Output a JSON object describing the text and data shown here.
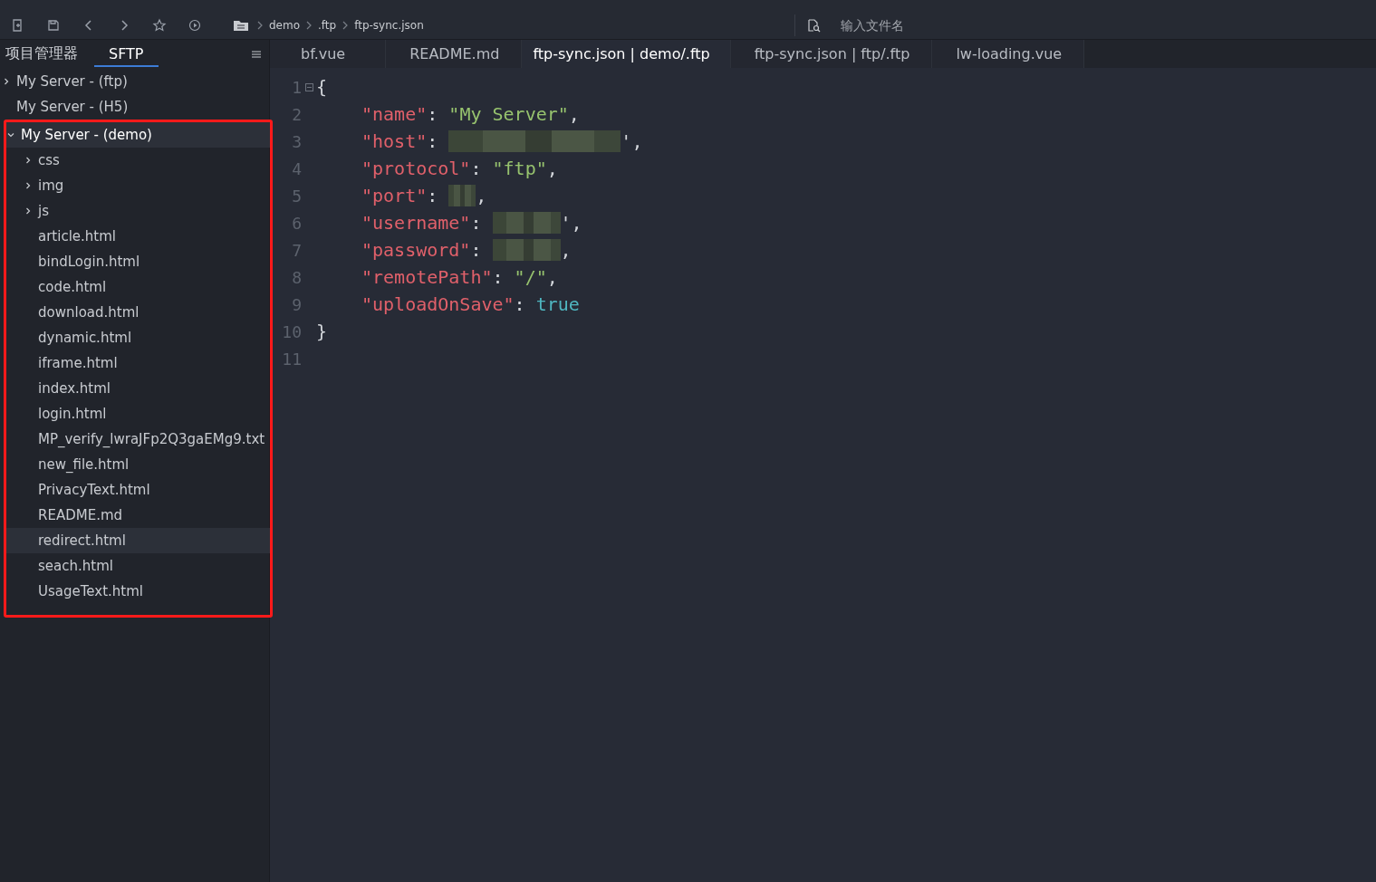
{
  "toolbar": {
    "breadcrumbs": [
      "demo",
      ".ftp",
      "ftp-sync.json"
    ],
    "search": {
      "placeholder": "输入文件名"
    }
  },
  "sidebar": {
    "tabs": [
      {
        "label": "项目管理器",
        "selected": false
      },
      {
        "label": "SFTP",
        "selected": true
      }
    ],
    "tree": [
      {
        "label": "My Server - (ftp)",
        "kind": "folder",
        "expanded": false,
        "selected": false,
        "highlighted": false
      },
      {
        "label": "My Server - (H5)",
        "kind": "file",
        "selected": false,
        "highlighted": false
      },
      {
        "label": "My Server - (demo)",
        "kind": "folder",
        "expanded": true,
        "selected": true,
        "highlighted": true,
        "children": [
          {
            "label": "css",
            "kind": "folder",
            "expanded": false,
            "selected": false
          },
          {
            "label": "img",
            "kind": "folder",
            "expanded": false,
            "selected": false
          },
          {
            "label": "js",
            "kind": "folder",
            "expanded": false,
            "selected": false
          },
          {
            "label": "article.html",
            "kind": "file",
            "selected": false
          },
          {
            "label": "bindLogin.html",
            "kind": "file",
            "selected": false
          },
          {
            "label": "code.html",
            "kind": "file",
            "selected": false
          },
          {
            "label": "download.html",
            "kind": "file",
            "selected": false
          },
          {
            "label": "dynamic.html",
            "kind": "file",
            "selected": false
          },
          {
            "label": "iframe.html",
            "kind": "file",
            "selected": false
          },
          {
            "label": "index.html",
            "kind": "file",
            "selected": false
          },
          {
            "label": "login.html",
            "kind": "file",
            "selected": false
          },
          {
            "label": "MP_verify_lwraJFp2Q3gaEMg9.txt",
            "kind": "file",
            "selected": false
          },
          {
            "label": "new_file.html",
            "kind": "file",
            "selected": false
          },
          {
            "label": "PrivacyText.html",
            "kind": "file",
            "selected": false
          },
          {
            "label": "README.md",
            "kind": "file",
            "selected": false
          },
          {
            "label": "redirect.html",
            "kind": "file",
            "selected": true
          },
          {
            "label": "seach.html",
            "kind": "file",
            "selected": false
          },
          {
            "label": "UsageText.html",
            "kind": "file",
            "selected": false
          }
        ]
      }
    ]
  },
  "editor": {
    "tabs": [
      {
        "label": "bf.vue",
        "selected": false
      },
      {
        "label": "README.md",
        "selected": false
      },
      {
        "label": "ftp-sync.json | demo/.ftp",
        "selected": true
      },
      {
        "label": "ftp-sync.json | ftp/.ftp",
        "selected": false
      },
      {
        "label": "lw-loading.vue",
        "selected": false
      }
    ],
    "lines": [
      {
        "number": "1",
        "fold": true,
        "tokens": [
          {
            "kind": "punct",
            "text": "{"
          }
        ]
      },
      {
        "number": "2",
        "tokens": [
          {
            "kind": "key",
            "text": "\"name\""
          },
          {
            "kind": "punct",
            "text": ": "
          },
          {
            "kind": "string",
            "text": "\"My Server\""
          },
          {
            "kind": "punct",
            "text": ","
          }
        ]
      },
      {
        "number": "3",
        "tokens": [
          {
            "kind": "key",
            "text": "\"host\""
          },
          {
            "kind": "punct",
            "text": ": "
          },
          {
            "kind": "redacted"
          },
          {
            "kind": "punct",
            "text": "',"
          }
        ]
      },
      {
        "number": "4",
        "tokens": [
          {
            "kind": "key",
            "text": "\"protocol\""
          },
          {
            "kind": "punct",
            "text": ": "
          },
          {
            "kind": "string",
            "text": "\"ftp\""
          },
          {
            "kind": "punct",
            "text": ","
          }
        ]
      },
      {
        "number": "5",
        "tokens": [
          {
            "kind": "key",
            "text": "\"port\""
          },
          {
            "kind": "punct",
            "text": ": "
          },
          {
            "kind": "redacted"
          },
          {
            "kind": "punct",
            "text": ","
          }
        ]
      },
      {
        "number": "6",
        "tokens": [
          {
            "kind": "key",
            "text": "\"username\""
          },
          {
            "kind": "punct",
            "text": ": "
          },
          {
            "kind": "redacted"
          },
          {
            "kind": "punct",
            "text": "',"
          }
        ]
      },
      {
        "number": "7",
        "tokens": [
          {
            "kind": "key",
            "text": "\"password\""
          },
          {
            "kind": "punct",
            "text": ": "
          },
          {
            "kind": "redacted"
          },
          {
            "kind": "punct",
            "text": ","
          }
        ]
      },
      {
        "number": "8",
        "tokens": [
          {
            "kind": "key",
            "text": "\"remotePath\""
          },
          {
            "kind": "punct",
            "text": ": "
          },
          {
            "kind": "string",
            "text": "\"/\""
          },
          {
            "kind": "punct",
            "text": ","
          }
        ]
      },
      {
        "number": "9",
        "tokens": [
          {
            "kind": "key",
            "text": "\"uploadOnSave\""
          },
          {
            "kind": "punct",
            "text": ": "
          },
          {
            "kind": "bool",
            "text": "true"
          }
        ]
      },
      {
        "number": "10",
        "tokens": [
          {
            "kind": "punct",
            "text": "}"
          }
        ]
      },
      {
        "number": "11"
      }
    ]
  }
}
